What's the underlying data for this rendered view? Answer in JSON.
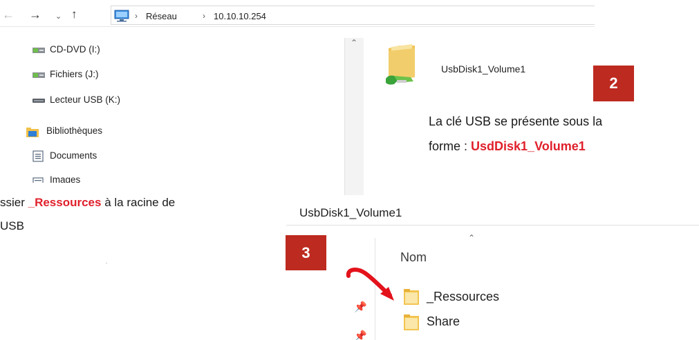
{
  "address_bar": {
    "crumbs": [
      "Réseau",
      "10.10.10.254"
    ]
  },
  "nav_tree": {
    "items": [
      {
        "label": "CD-DVD (I:)",
        "icon": "network-drive-icon"
      },
      {
        "label": "Fichiers (J:)",
        "icon": "network-drive-icon"
      },
      {
        "label": "Lecteur USB (K:)",
        "icon": "usb-drive-icon"
      },
      {
        "label": "Bibliothèques",
        "icon": "libraries-icon"
      },
      {
        "label": "Documents",
        "icon": "documents-icon"
      },
      {
        "label": "Images",
        "icon": "images-icon"
      }
    ]
  },
  "network_share": {
    "name": "UsbDisk1_Volume1",
    "icon": "shared-folder-icon"
  },
  "step2": {
    "badge": "2",
    "caption_line1": "La clé USB se présente sous la",
    "caption_line2_prefix": "forme : ",
    "caption_line2_highlight": "UsdDisk1_Volume1"
  },
  "step_left_caption": {
    "line1_prefix": "ssier ",
    "line1_highlight": "_Ressources",
    "line1_suffix": " à la racine de",
    "line2": "USB"
  },
  "explorer2": {
    "title": "UsbDisk1_Volume1",
    "column_header": "Nom",
    "files": [
      {
        "name": "_Ressources",
        "icon": "folder-icon",
        "highlighted": true
      },
      {
        "name": "Share",
        "icon": "folder-icon"
      }
    ]
  },
  "step3": {
    "badge": "3"
  },
  "colors": {
    "badge": "#bd2a1f",
    "highlight_text": "#e0202b",
    "arrow": "#e3121b",
    "folder": "#f5d27a"
  }
}
